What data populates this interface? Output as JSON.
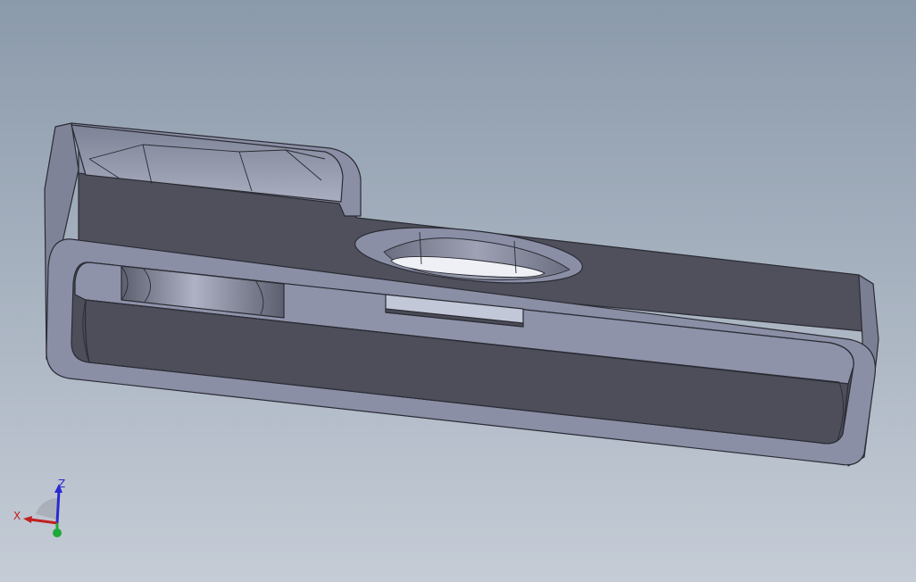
{
  "viewport": {
    "background_top": "#8b9aab",
    "background_bottom": "#c3cad4",
    "part_color": "#8a8fa6",
    "part_shadow": "#4f505c",
    "edge_color": "#2b2b33"
  },
  "triad": {
    "z_label": "Z",
    "x_label": "X",
    "z_color": "#2a2ad0",
    "x_color": "#c02020",
    "y_color": "#1faa3a"
  }
}
